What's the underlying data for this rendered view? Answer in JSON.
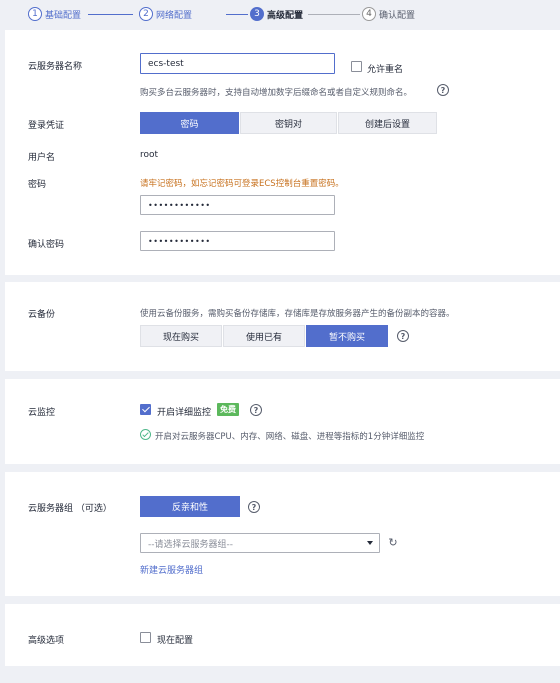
{
  "steps": [
    {
      "num": "1",
      "label": "基础配置"
    },
    {
      "num": "2",
      "label": "网络配置"
    },
    {
      "num": "3",
      "label": "高级配置"
    },
    {
      "num": "4",
      "label": "确认配置"
    }
  ],
  "basic": {
    "name_label": "云服务器名称",
    "name_value": "ecs-test",
    "allow_dup_label": "允许重名",
    "name_hint": "购买多台云服务器时，支持自动增加数字后缀命名或者自定义规则命名。",
    "credential_label": "登录凭证",
    "credential_options": [
      "密码",
      "密钥对",
      "创建后设置"
    ],
    "username_label": "用户名",
    "username_value": "root",
    "password_label": "密码",
    "password_warning": "请牢记密码，如忘记密码可登录ECS控制台重置密码。",
    "password_value": "••••••••••••",
    "confirm_label": "确认密码",
    "confirm_value": "••••••••••••"
  },
  "backup": {
    "label": "云备份",
    "hint": "使用云备份服务，需购买备份存储库，存储库是存放服务器产生的备份副本的容器。",
    "options": [
      "现在购买",
      "使用已有",
      "暂不购买"
    ]
  },
  "monitor": {
    "label": "云监控",
    "checkbox_label": "开启详细监控",
    "badge": "免费",
    "info": "开启对云服务器CPU、内存、网络、磁盘、进程等指标的1分钟详细监控"
  },
  "group": {
    "label": "云服务器组 （可选）",
    "button": "反亲和性",
    "select_placeholder": "--请选择云服务器组--",
    "new_link": "新建云服务器组"
  },
  "advanced": {
    "label": "高级选项",
    "checkbox_label": "现在配置"
  }
}
